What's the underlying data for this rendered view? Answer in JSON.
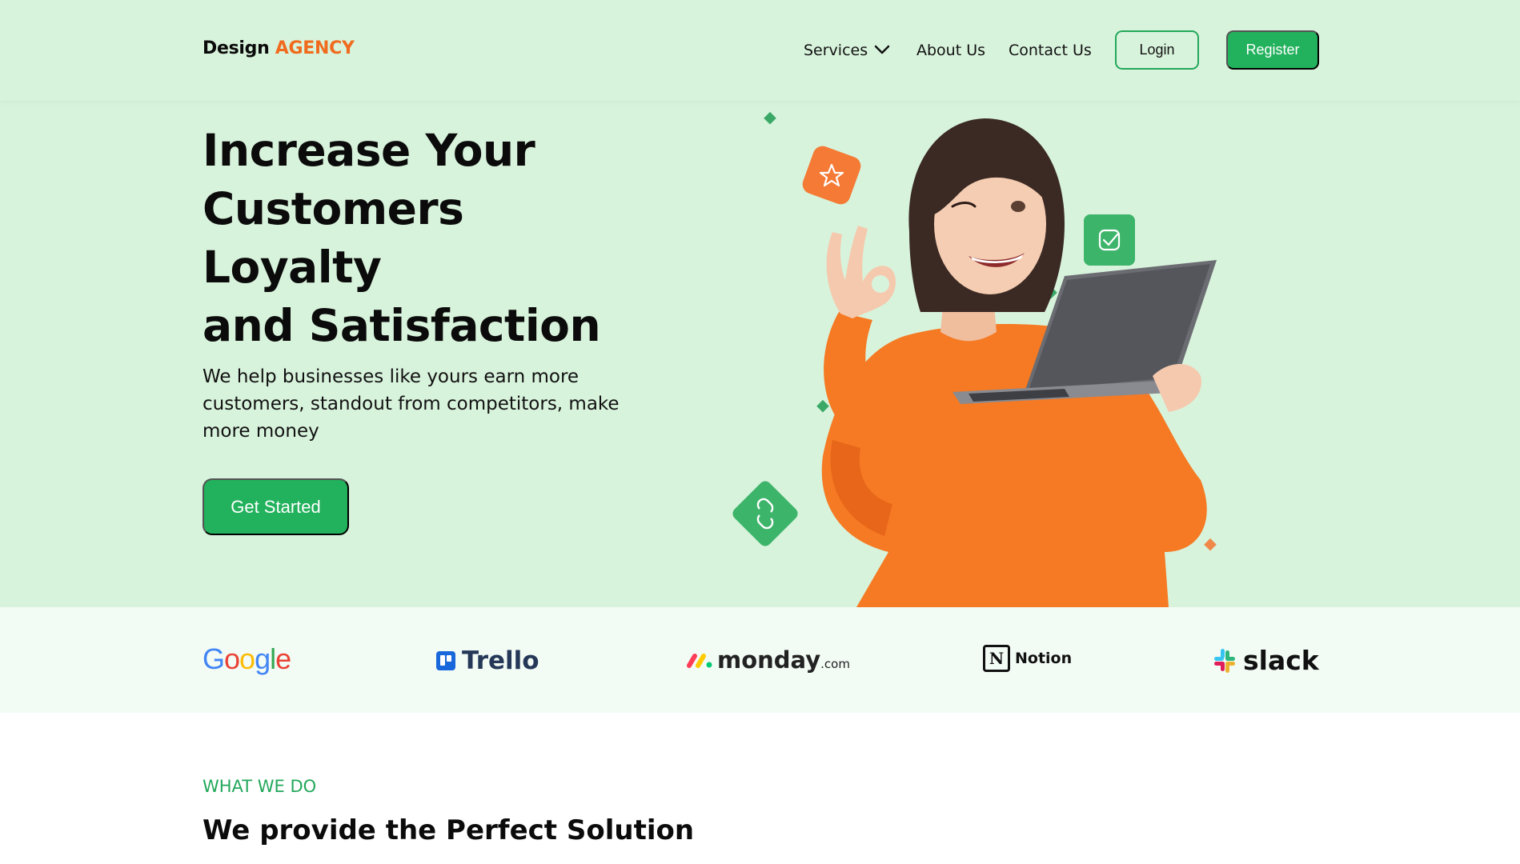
{
  "nav": {
    "logo_main": "Design",
    "logo_accent": "AGENCY",
    "services": "Services",
    "about": "About Us",
    "contact": "Contact Us",
    "login": "Login",
    "register": "Register"
  },
  "hero": {
    "headline_lines": [
      "Increase Your",
      "Customers",
      "Loyalty",
      "and Satisfaction"
    ],
    "subtext": "We help businesses like yours earn more customers, standout from competitors, make more money",
    "cta": "Get Started"
  },
  "partners": {
    "google": "Google",
    "trello": "Trello",
    "monday": "monday",
    "monday_suffix": ".com",
    "notion": "Notion",
    "notion_mark": "N",
    "slack": "slack"
  },
  "section": {
    "eyebrow": "WHAT WE DO",
    "title": "We provide the Perfect Solution"
  },
  "colors": {
    "brand_green": "#22b15c",
    "accent_orange": "#f06b1d",
    "hero_bg": "#d8f3dc"
  },
  "icons": [
    "chevron-down-icon",
    "star-icon",
    "check-icon",
    "link-icon",
    "slack-logo-icon",
    "trello-logo-icon",
    "monday-logo-icon",
    "notion-logo-icon"
  ]
}
